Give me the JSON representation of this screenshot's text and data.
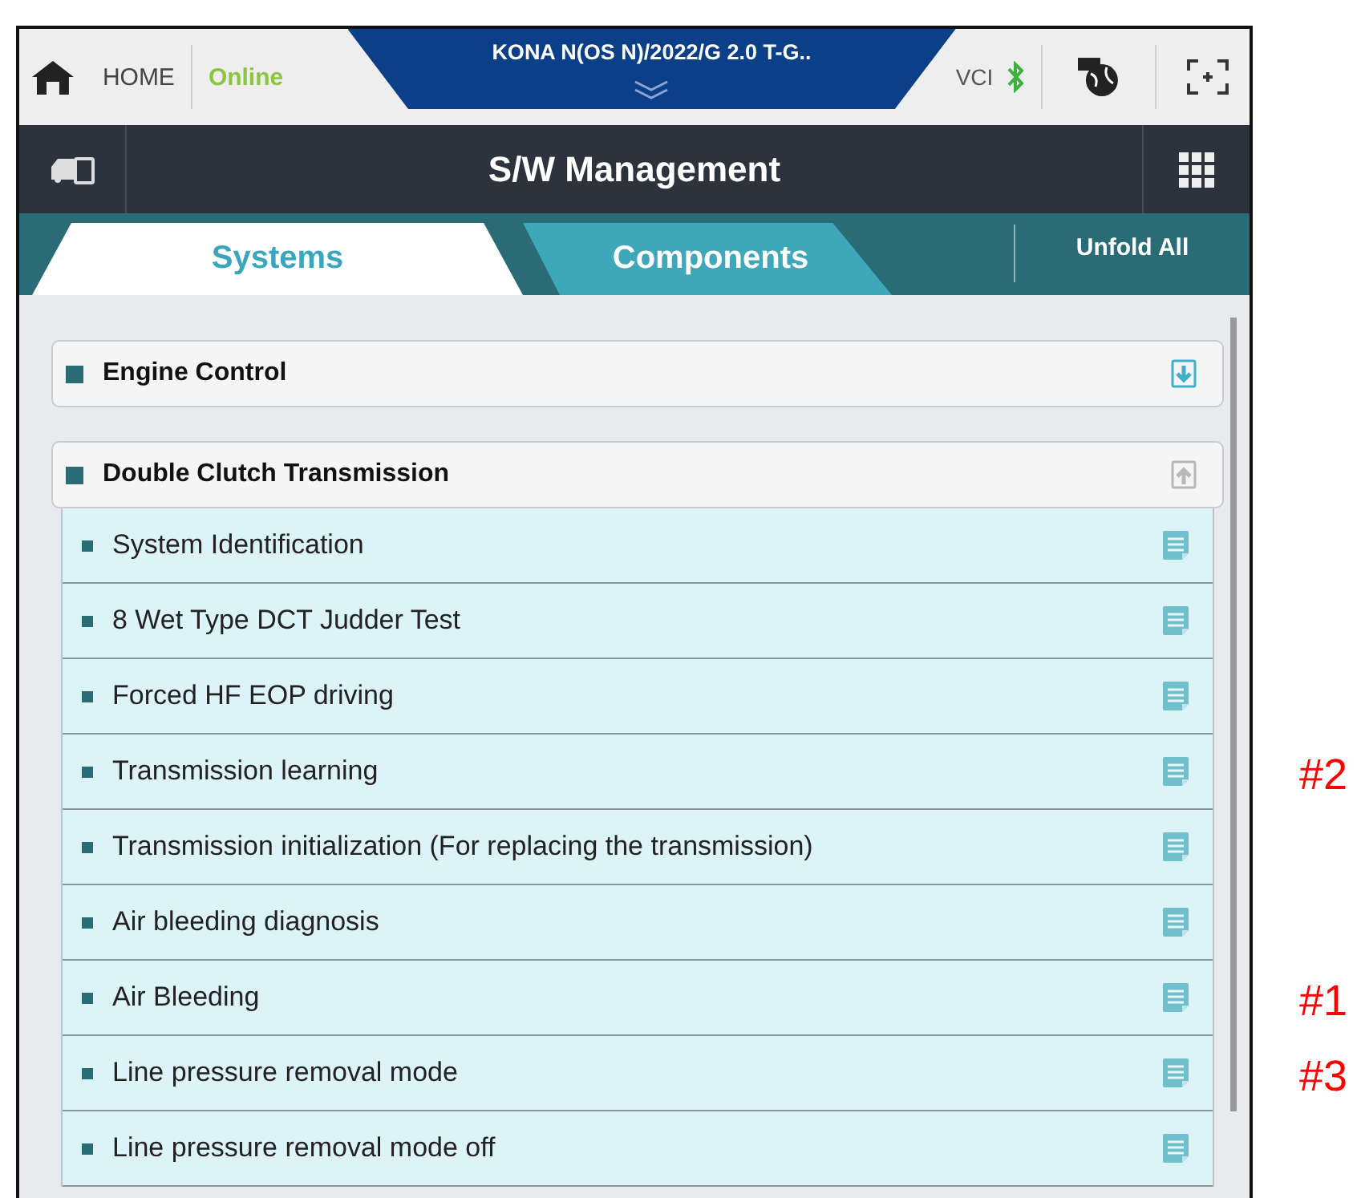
{
  "top_bar": {
    "home_label": "HOME",
    "connection": "Online",
    "vehicle": "KONA N(OS N)/2022/G 2.0 T-G..",
    "vci_label": "VCI"
  },
  "header": {
    "title": "S/W Management"
  },
  "tabs": [
    {
      "label": "Systems",
      "selected": true
    },
    {
      "label": "Components",
      "selected": false
    }
  ],
  "unfold_all": "Unfold All",
  "groups": [
    {
      "label": "Engine Control",
      "expanded": false
    },
    {
      "label": "Double Clutch Transmission",
      "expanded": true,
      "items": [
        {
          "label": "System Identification"
        },
        {
          "label": "8 Wet Type DCT Judder Test"
        },
        {
          "label": "Forced HF EOP driving"
        },
        {
          "label": "Transmission learning",
          "note": "#2"
        },
        {
          "label": "Transmission initialization (For replacing the transmission)"
        },
        {
          "label": "Air bleeding diagnosis"
        },
        {
          "label": "Air Bleeding",
          "note": "#1"
        },
        {
          "label": "Line pressure removal mode",
          "note": "#3"
        },
        {
          "label": "Line pressure removal mode off"
        }
      ]
    }
  ]
}
